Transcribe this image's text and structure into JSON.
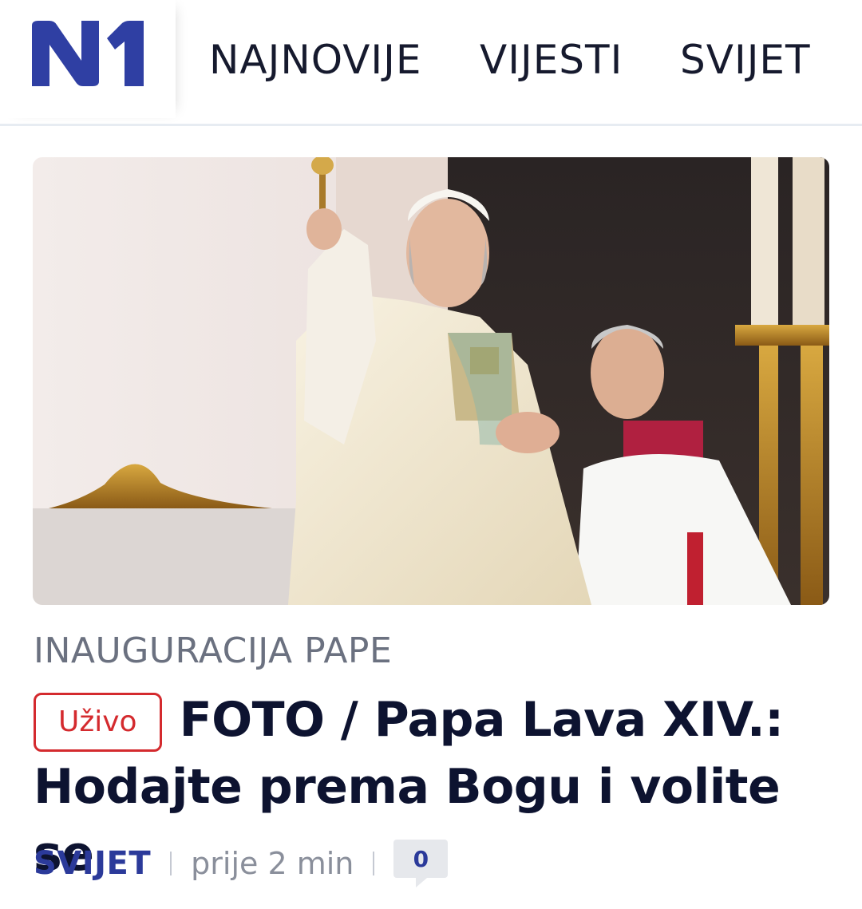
{
  "header": {
    "logo_text": "N1",
    "brand_color": "#2f3fa3",
    "nav": [
      {
        "label": "NAJNOVIJE"
      },
      {
        "label": "VIJESTI"
      },
      {
        "label": "SVIJET"
      }
    ]
  },
  "article": {
    "image_icon": "photo-pope-blessing",
    "category": "INAUGURACIJA PAPE",
    "live_badge": "Uživo",
    "live_color": "#d42a2e",
    "headline": "FOTO / Papa Lava XIV.: Hodajte prema Bogu i volite se",
    "section": "SVIJET",
    "time": "prije 2 min",
    "comment_count": "0"
  }
}
